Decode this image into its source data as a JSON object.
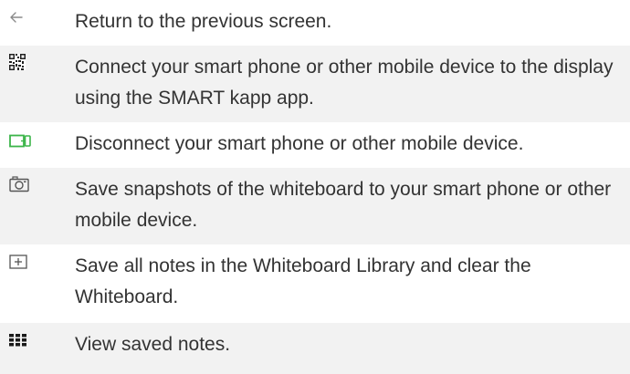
{
  "rows": [
    {
      "icon": "back-arrow-icon",
      "text": "Return to the previous screen."
    },
    {
      "icon": "qr-code-icon",
      "text": "Connect your smart phone or other mobile device to the display using the SMART kapp app."
    },
    {
      "icon": "disconnect-device-icon",
      "text": "Disconnect your smart phone or other mobile device.",
      "icon_color": "#3cb54a"
    },
    {
      "icon": "camera-icon",
      "text": "Save snapshots of the whiteboard to your smart phone or other mobile device."
    },
    {
      "icon": "new-note-icon",
      "text": "Save all notes in the Whiteboard Library and clear the Whiteboard."
    },
    {
      "icon": "grid-icon",
      "text": "View saved notes."
    }
  ],
  "colors": {
    "row_shade": "#f2f2f2",
    "text": "#333333",
    "icon_gray": "#888888",
    "icon_green": "#3cb54a",
    "icon_dark": "#222222"
  }
}
